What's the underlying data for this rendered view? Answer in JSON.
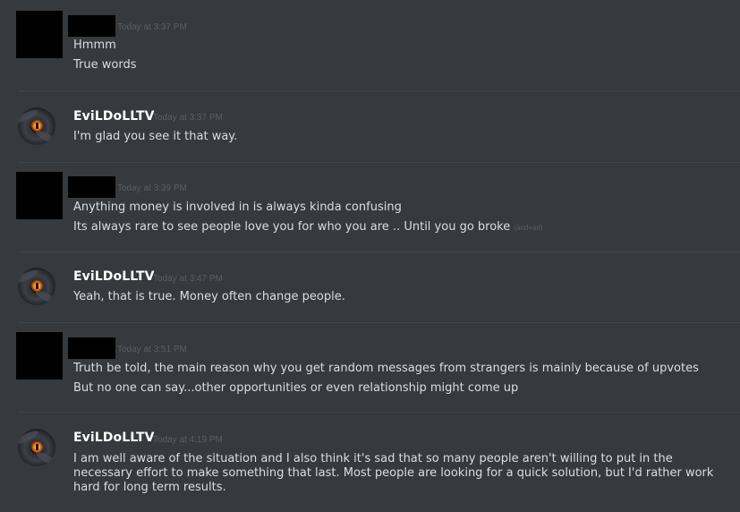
{
  "messages": [
    {
      "author": "",
      "author_redacted": true,
      "timestamp": "Today at 3:37 PM",
      "lines": [
        "Hmmm",
        "True words"
      ]
    },
    {
      "author": "EviLDoLLTV",
      "author_redacted": false,
      "avatar": "doll-eye-avatar",
      "timestamp": "Today at 3:37 PM",
      "lines": [
        "I'm glad you see it that way."
      ]
    },
    {
      "author": "",
      "author_redacted": true,
      "timestamp": "Today at 3:39 PM",
      "lines": [
        "Anything money is involved in is always kinda confusing",
        "Its always rare to see people love you for who you are .. Until you go broke"
      ],
      "edited_label": "(änd+ad)"
    },
    {
      "author": "EviLDoLLTV",
      "author_redacted": false,
      "avatar": "doll-eye-avatar",
      "timestamp": "Today at 3:47 PM",
      "lines": [
        "Yeah, that is true. Money often change people."
      ]
    },
    {
      "author": "",
      "author_redacted": true,
      "timestamp": "Today at 3:51 PM",
      "lines": [
        "Truth be told, the main reason why you get random messages from strangers is mainly because of upvotes",
        "But no one can say...other opportunities or even relationship might come up"
      ]
    },
    {
      "author": "EviLDoLLTV",
      "author_redacted": false,
      "avatar": "doll-eye-avatar",
      "timestamp": "Today at 4:19 PM",
      "lines": [
        "I am well aware of the situation and I also think it's sad that so many people aren't willing to put in the necessary effort to make something that last. Most people are looking for a quick solution, but I'd rather work hard for long term results."
      ]
    }
  ],
  "colors": {
    "background": "#36393e",
    "divider": "#42454a",
    "text": "#dcddde",
    "username": "#ffffff",
    "timestamp": "#5c5e63"
  }
}
